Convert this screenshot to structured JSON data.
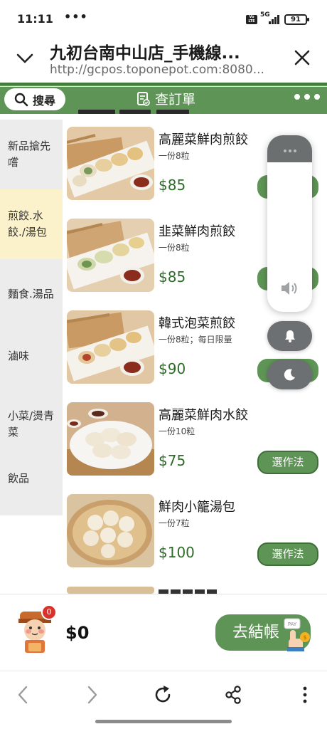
{
  "status_bar": {
    "time": "11:11",
    "more": "•••",
    "lte": "Vo LTE",
    "network": "5G",
    "battery": "91"
  },
  "browser": {
    "page_title": "九初台南中山店_手機線...",
    "url": "http://gcpos.toponepot.com:8080..."
  },
  "app_header": {
    "search_label": "搜尋",
    "title": "查訂單"
  },
  "categories": [
    {
      "label": "新品搶先嚐",
      "active": false
    },
    {
      "label": "煎餃.水餃./湯包",
      "active": true
    },
    {
      "label": "麵食.湯品",
      "active": false
    },
    {
      "label": "滷味",
      "active": false
    },
    {
      "label": "小菜/燙青菜",
      "active": false
    },
    {
      "label": "飲品",
      "active": false
    }
  ],
  "products": [
    {
      "name": "高麗菜鮮肉煎餃",
      "desc": "一份8粒",
      "price": "$85",
      "button": ""
    },
    {
      "name": "韭菜鮮肉煎餃",
      "desc": "一份8粒",
      "price": "$85",
      "button": ""
    },
    {
      "name": "韓式泡菜煎餃",
      "desc": "一份8粒；每日限量",
      "price": "$90",
      "button": ""
    },
    {
      "name": "高麗菜鮮肉水餃",
      "desc": "一份10粒",
      "price": "$75",
      "button": "選作法"
    },
    {
      "name": "鮮肉小籠湯包",
      "desc": "一份7粒",
      "price": "$100",
      "button": "選作法"
    }
  ],
  "cart": {
    "count": "0",
    "total": "$0",
    "checkout_label": "去結帳",
    "pay_label": "PAY"
  },
  "colors": {
    "brand_green": "#5e9456",
    "price_green": "#2f6b2a",
    "active_category": "#fbf2cc",
    "badge_red": "#d9322a"
  },
  "icons": {
    "browser_nav": [
      "back-icon",
      "forward-icon",
      "reload-icon",
      "share-icon",
      "menu-icon"
    ]
  }
}
